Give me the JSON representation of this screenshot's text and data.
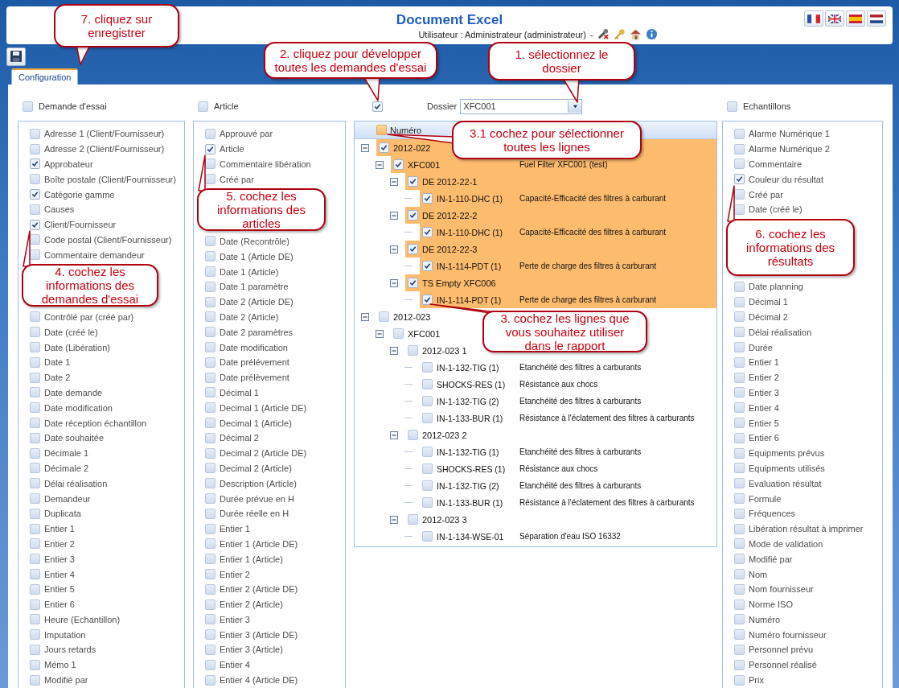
{
  "header": {
    "title": "Document Excel",
    "user_label": "Utilisateur : Administrateur (administrateur)",
    "separator": "-"
  },
  "toolbar": {
    "tabs": [
      {
        "label": "Configuration",
        "selected": true
      }
    ]
  },
  "columns": [
    {
      "title": "Demande d'essai",
      "checked": false,
      "items": [
        {
          "label": "Adresse 1 (Client/Fournisseur)",
          "checked": false
        },
        {
          "label": "Adresse 2 (Client/Fournisseur)",
          "checked": false
        },
        {
          "label": "Approbateur",
          "checked": true
        },
        {
          "label": "Boîte postale (Client/Fournisseur)",
          "checked": false
        },
        {
          "label": "Catégorie gamme",
          "checked": true
        },
        {
          "label": "Causes",
          "checked": false
        },
        {
          "label": "Client/Fournisseur",
          "checked": true
        },
        {
          "label": "Code postal (Client/Fournisseur)",
          "checked": false
        },
        {
          "label": "Commentaire demandeur",
          "checked": false
        },
        {
          "label": "Contrôlé par (créé par)",
          "checked": false
        },
        {
          "label": "Date (créé le)",
          "checked": false
        },
        {
          "label": "Date (Libération)",
          "checked": false
        },
        {
          "label": "Date 1",
          "checked": false
        },
        {
          "label": "Date 2",
          "checked": false
        },
        {
          "label": "Date demande",
          "checked": false
        },
        {
          "label": "Date modification",
          "checked": false
        },
        {
          "label": "Date réception échantillon",
          "checked": false
        },
        {
          "label": "Date souhaitée",
          "checked": false
        },
        {
          "label": "Décimale 1",
          "checked": false
        },
        {
          "label": "Décimale 2",
          "checked": false
        },
        {
          "label": "Délai réalisation",
          "checked": false
        },
        {
          "label": "Demandeur",
          "checked": false
        },
        {
          "label": "Duplicata",
          "checked": false
        },
        {
          "label": "Entier 1",
          "checked": false
        },
        {
          "label": "Entier 2",
          "checked": false
        },
        {
          "label": "Entier 3",
          "checked": false
        },
        {
          "label": "Entier 4",
          "checked": false
        },
        {
          "label": "Entier 5",
          "checked": false
        },
        {
          "label": "Entier 6",
          "checked": false
        },
        {
          "label": "Heure (Echantillon)",
          "checked": false
        },
        {
          "label": "Imputation",
          "checked": false
        },
        {
          "label": "Jours retards",
          "checked": false
        },
        {
          "label": "Mémo 1",
          "checked": false
        },
        {
          "label": "Modifié par",
          "checked": false
        }
      ]
    },
    {
      "title": "Article",
      "checked": false,
      "items": [
        {
          "label": "Approuvé par",
          "checked": false
        },
        {
          "label": "Article",
          "checked": true
        },
        {
          "label": "Commentaire libération",
          "checked": false
        },
        {
          "label": "Créé par",
          "checked": false
        },
        {
          "label": "Date (Recontrôle)",
          "checked": false
        },
        {
          "label": "Date 1 (Article DE)",
          "checked": false
        },
        {
          "label": "Date 1 (Article)",
          "checked": false
        },
        {
          "label": "Date 1 paramètre",
          "checked": false
        },
        {
          "label": "Date 2 (Article DE)",
          "checked": false
        },
        {
          "label": "Date 2 (Article)",
          "checked": false
        },
        {
          "label": "Date 2 paramètres",
          "checked": false
        },
        {
          "label": "Date modification",
          "checked": false
        },
        {
          "label": "Date prélévement",
          "checked": false
        },
        {
          "label": "Date prélèvement",
          "checked": false
        },
        {
          "label": "Décimal 1",
          "checked": false
        },
        {
          "label": "Decimal 1 (Article DE)",
          "checked": false
        },
        {
          "label": "Decimal 1 (Article)",
          "checked": false
        },
        {
          "label": "Décimal 2",
          "checked": false
        },
        {
          "label": "Decimal 2 (Article DE)",
          "checked": false
        },
        {
          "label": "Decimal 2 (Article)",
          "checked": false
        },
        {
          "label": "Description (Article)",
          "checked": false
        },
        {
          "label": "Durée prévue en H",
          "checked": false
        },
        {
          "label": "Durée réelle en H",
          "checked": false
        },
        {
          "label": "Entier 1",
          "checked": false
        },
        {
          "label": "Entier 1 (Article DE)",
          "checked": false
        },
        {
          "label": "Entier 1 (Article)",
          "checked": false
        },
        {
          "label": "Entier 2",
          "checked": false
        },
        {
          "label": "Entier 2 (Article DE)",
          "checked": false
        },
        {
          "label": "Entier 2 (Article)",
          "checked": false
        },
        {
          "label": "Entier 3",
          "checked": false
        },
        {
          "label": "Entier 3 (Article DE)",
          "checked": false
        },
        {
          "label": "Entier 3 (Article)",
          "checked": false
        },
        {
          "label": "Entier 4",
          "checked": false
        },
        {
          "label": "Entier 4 (Article DE)",
          "checked": false
        }
      ]
    },
    {
      "title": "Echantillons",
      "checked": false,
      "items": [
        {
          "label": "Alarme Numérique 1",
          "checked": false
        },
        {
          "label": "Alarme Numérique 2",
          "checked": false
        },
        {
          "label": "Commentaire",
          "checked": false
        },
        {
          "label": "Couleur du résultat",
          "checked": true
        },
        {
          "label": "Créé par",
          "checked": false
        },
        {
          "label": "Date (créé le)",
          "checked": false
        },
        {
          "label": "Date planning",
          "checked": false
        },
        {
          "label": "Décimal 1",
          "checked": false
        },
        {
          "label": "Décimal 2",
          "checked": false
        },
        {
          "label": "Délai réalisation",
          "checked": false
        },
        {
          "label": "Durée",
          "checked": false
        },
        {
          "label": "Entier 1",
          "checked": false
        },
        {
          "label": "Entier 2",
          "checked": false
        },
        {
          "label": "Entier 3",
          "checked": false
        },
        {
          "label": "Entier 4",
          "checked": false
        },
        {
          "label": "Entier 5",
          "checked": false
        },
        {
          "label": "Entier 6",
          "checked": false
        },
        {
          "label": "Equipments prévus",
          "checked": false
        },
        {
          "label": "Equipments utilisés",
          "checked": false
        },
        {
          "label": "Evaluation résultat",
          "checked": false
        },
        {
          "label": "Formule",
          "checked": false
        },
        {
          "label": "Fréquences",
          "checked": false
        },
        {
          "label": "Libération résultat à imprimer",
          "checked": false
        },
        {
          "label": "Mode de validation",
          "checked": false
        },
        {
          "label": "Modifié par",
          "checked": false
        },
        {
          "label": "Nom",
          "checked": false
        },
        {
          "label": "Nom fournisseur",
          "checked": false
        },
        {
          "label": "Norme ISO",
          "checked": false
        },
        {
          "label": "Numéro",
          "checked": false
        },
        {
          "label": "Numéro fournisseur",
          "checked": false
        },
        {
          "label": "Personnel prévu",
          "checked": false
        },
        {
          "label": "Personnel réalisé",
          "checked": false
        },
        {
          "label": "Prix",
          "checked": false
        }
      ]
    }
  ],
  "dossier": {
    "expand_all_checked": true,
    "label": "Dossier",
    "value": "XFC001"
  },
  "tree": {
    "header": {
      "label": "Numéro",
      "checked": false
    },
    "rows": [
      {
        "number": "2012-022",
        "checked": true,
        "selected": true,
        "expanded": true,
        "children": [
          {
            "number": "XFC001",
            "description": "Fuel Filter XFC001 (test)",
            "checked": true,
            "selected": true,
            "expanded": true,
            "children": [
              {
                "number": "DE 2012-22-1",
                "checked": true,
                "selected": true,
                "expanded": true,
                "children": [
                  {
                    "number": "IN-1-110-DHC (1)",
                    "description": "Capacité-Efficacité des filtres à carburant",
                    "checked": true,
                    "selected": true
                  }
                ]
              },
              {
                "number": "DE 2012-22-2",
                "checked": true,
                "selected": true,
                "expanded": true,
                "children": [
                  {
                    "number": "IN-1-110-DHC (1)",
                    "description": "Capacité-Efficacité des filtres à carburant",
                    "checked": true,
                    "selected": true
                  }
                ]
              },
              {
                "number": "DE 2012-22-3",
                "checked": true,
                "selected": true,
                "expanded": true,
                "children": [
                  {
                    "number": "IN-1-114-PDT (1)",
                    "description": "Perte de charge des filtres à carburant",
                    "checked": true,
                    "selected": true
                  }
                ]
              },
              {
                "number": "TS Empty XFC006",
                "checked": true,
                "selected": true,
                "expanded": true,
                "children": [
                  {
                    "number": "IN-1-114-PDT (1)",
                    "description": "Perte de charge des filtres à carburant",
                    "checked": true,
                    "selected": true
                  }
                ]
              }
            ]
          }
        ]
      },
      {
        "number": "2012-023",
        "checked": false,
        "selected": false,
        "expanded": true,
        "children": [
          {
            "number": "XFC001",
            "checked": false,
            "selected": false,
            "expanded": true,
            "children": [
              {
                "number": "2012-023 1",
                "checked": false,
                "selected": false,
                "expanded": true,
                "children": [
                  {
                    "number": "IN-1-132-TIG (1)",
                    "description": "Etanchéité des filtres à carburants",
                    "checked": false,
                    "selected": false
                  },
                  {
                    "number": "SHOCKS-RES (1)",
                    "description": "Résistance aux chocs",
                    "checked": false,
                    "selected": false
                  },
                  {
                    "number": "IN-1-132-TIG (2)",
                    "description": "Etanchéité des filtres à carburants",
                    "checked": false,
                    "selected": false
                  },
                  {
                    "number": "IN-1-133-BUR (1)",
                    "description": "Résistance à l'éclatement des filtres à carburants",
                    "checked": false,
                    "selected": false
                  }
                ]
              },
              {
                "number": "2012-023 2",
                "checked": false,
                "selected": false,
                "expanded": true,
                "children": [
                  {
                    "number": "IN-1-132-TIG (1)",
                    "description": "Etanchéité des filtres à carburants",
                    "checked": false,
                    "selected": false
                  },
                  {
                    "number": "SHOCKS-RES (1)",
                    "description": "Résistance aux chocs",
                    "checked": false,
                    "selected": false
                  },
                  {
                    "number": "IN-1-132-TIG (2)",
                    "description": "Etanchéité des filtres à carburants",
                    "checked": false,
                    "selected": false
                  },
                  {
                    "number": "IN-1-133-BUR (1)",
                    "description": "Résistance à l'éclatement des filtres à carburants",
                    "checked": false,
                    "selected": false
                  }
                ]
              },
              {
                "number": "2012-023 3",
                "checked": false,
                "selected": false,
                "expanded": true,
                "children": [
                  {
                    "number": "IN-1-134-WSE-01",
                    "description": "Séparation d'eau ISO 16332",
                    "checked": false,
                    "selected": false
                  }
                ]
              }
            ]
          }
        ]
      }
    ]
  },
  "callouts": [
    {
      "text": "7. cliquez sur\nenregistrer"
    },
    {
      "text": "2. cliquez pour développer\ntoutes les demandes d'essai"
    },
    {
      "text": "1. sélectionnez le\ndossier"
    },
    {
      "text": "3.1 cochez pour sélectionner\ntoutes les lignes"
    },
    {
      "text": "5. cochez les\ninformations des\narticles"
    },
    {
      "text": "4. cochez les\ninformations des\ndemandes d'essai"
    },
    {
      "text": "6. cochez les\ninformations des\nrésultats"
    },
    {
      "text": "3. cochez les lignes que\nvous souhaitez utiliser\ndans le rapport"
    }
  ]
}
